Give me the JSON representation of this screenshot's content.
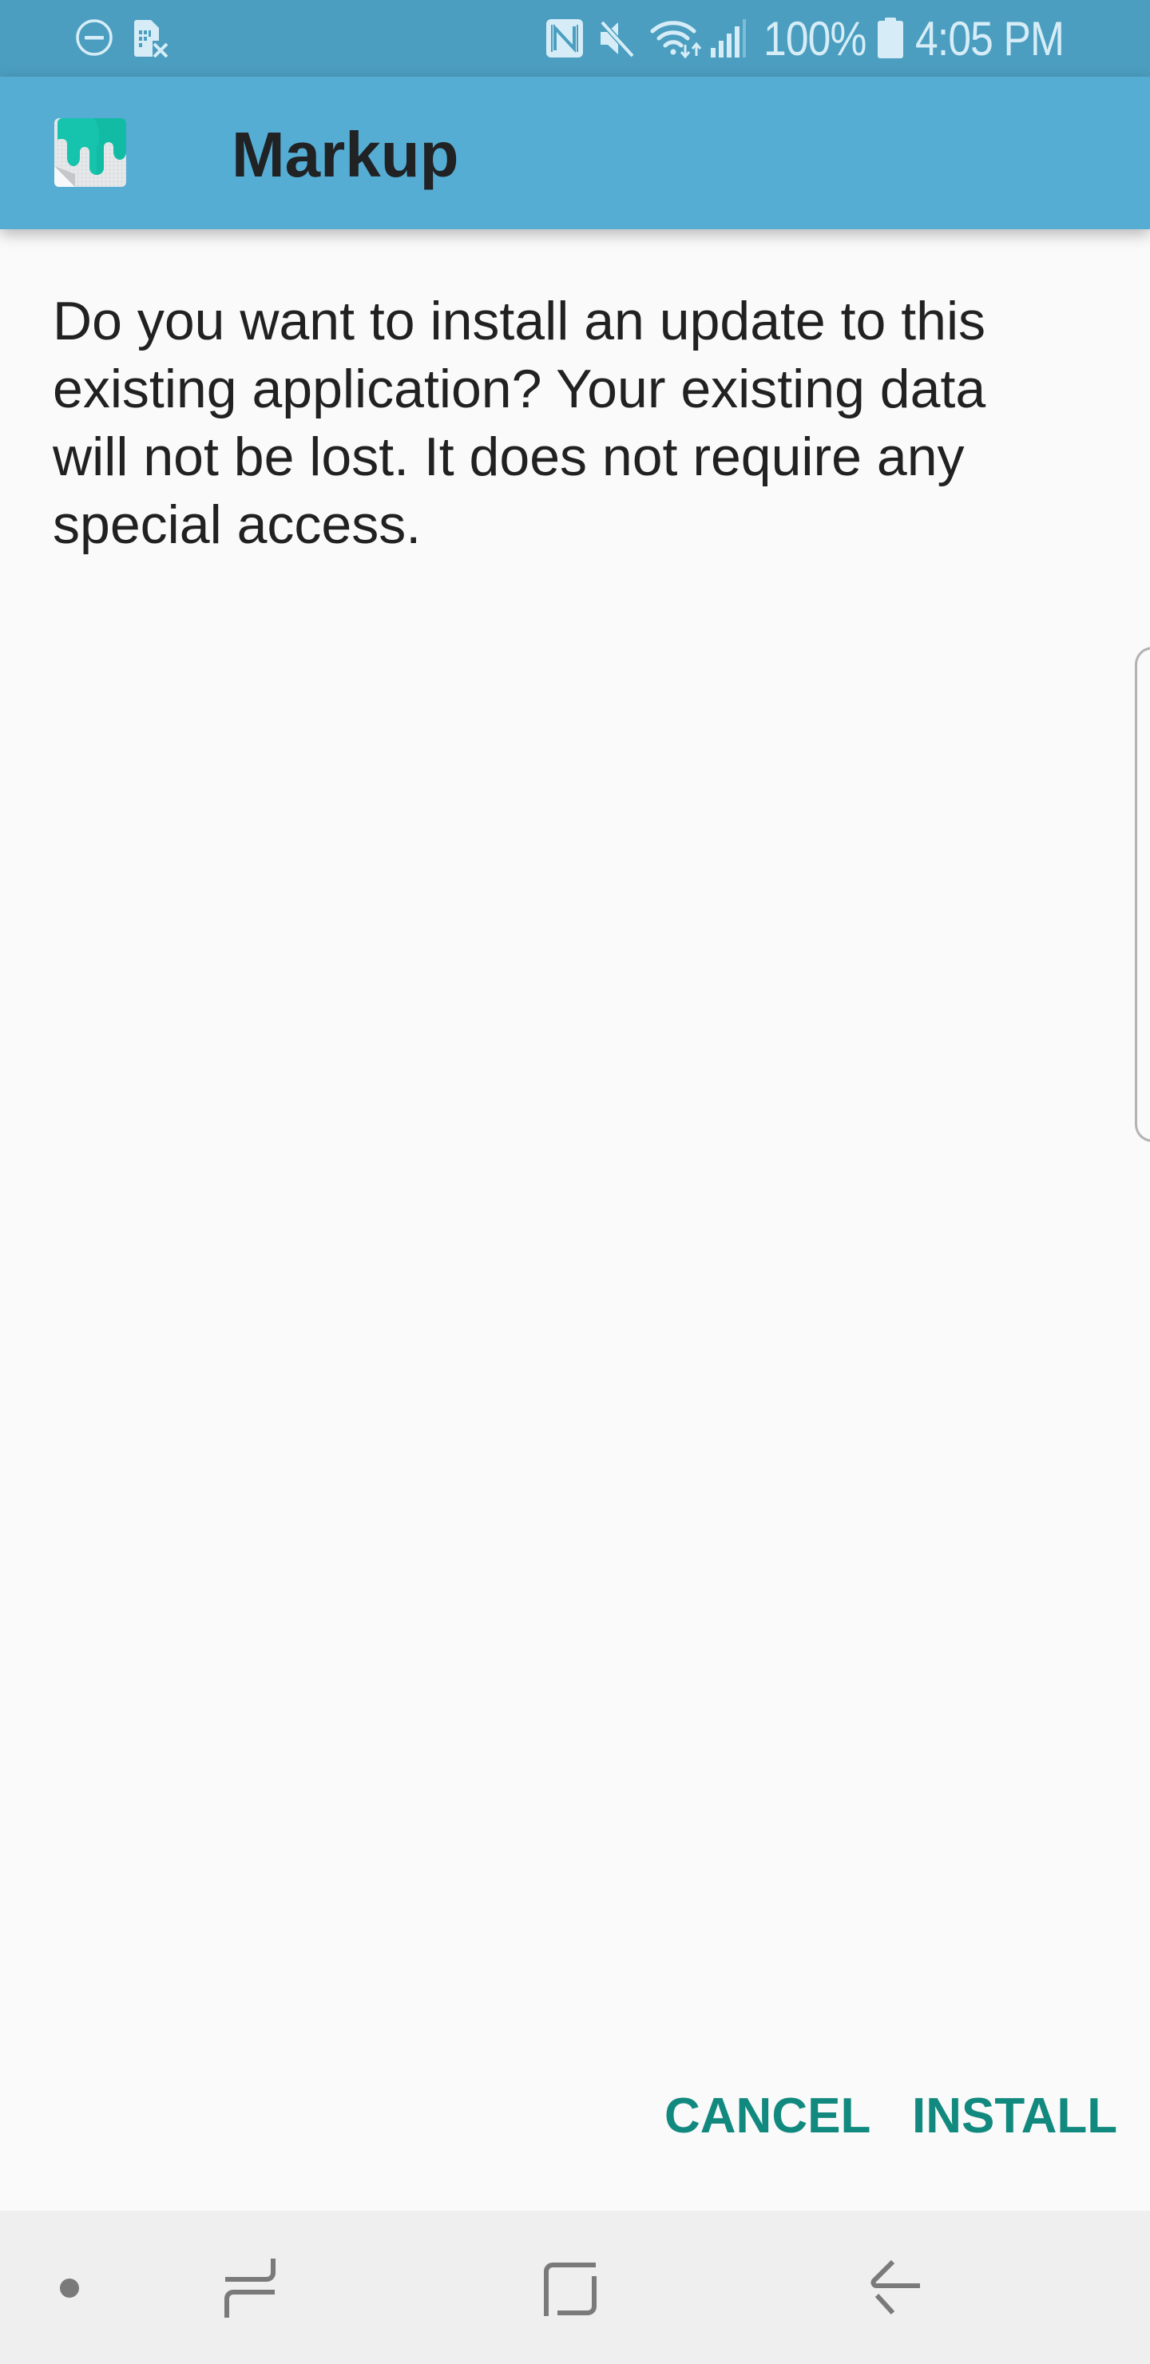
{
  "status_bar": {
    "left_icons": [
      "do-not-disturb-icon",
      "no-sim-icon"
    ],
    "right_icons": [
      "nfc-icon",
      "mute-icon",
      "wifi-icon",
      "cellular-signal-icon",
      "battery-icon"
    ],
    "battery_percent": "100%",
    "time": "4:05 PM"
  },
  "app_bar": {
    "app_icon": "markup-app-icon",
    "title": "Markup"
  },
  "dialog": {
    "message_lines": [
      "Do you want to install an update to this",
      "existing application? Your existing data",
      "will not be lost. It does not require any",
      "special access."
    ],
    "cancel_label": "CANCEL",
    "install_label": "INSTALL",
    "accent_color": "#12897e"
  },
  "nav_bar": {
    "buttons": [
      "hide-keyboard-dot",
      "recents",
      "home",
      "back"
    ]
  },
  "colors": {
    "status_bar": "#4b9ec0",
    "app_bar": "#55add4",
    "background": "#fafafa",
    "nav_bar": "#efefef"
  }
}
